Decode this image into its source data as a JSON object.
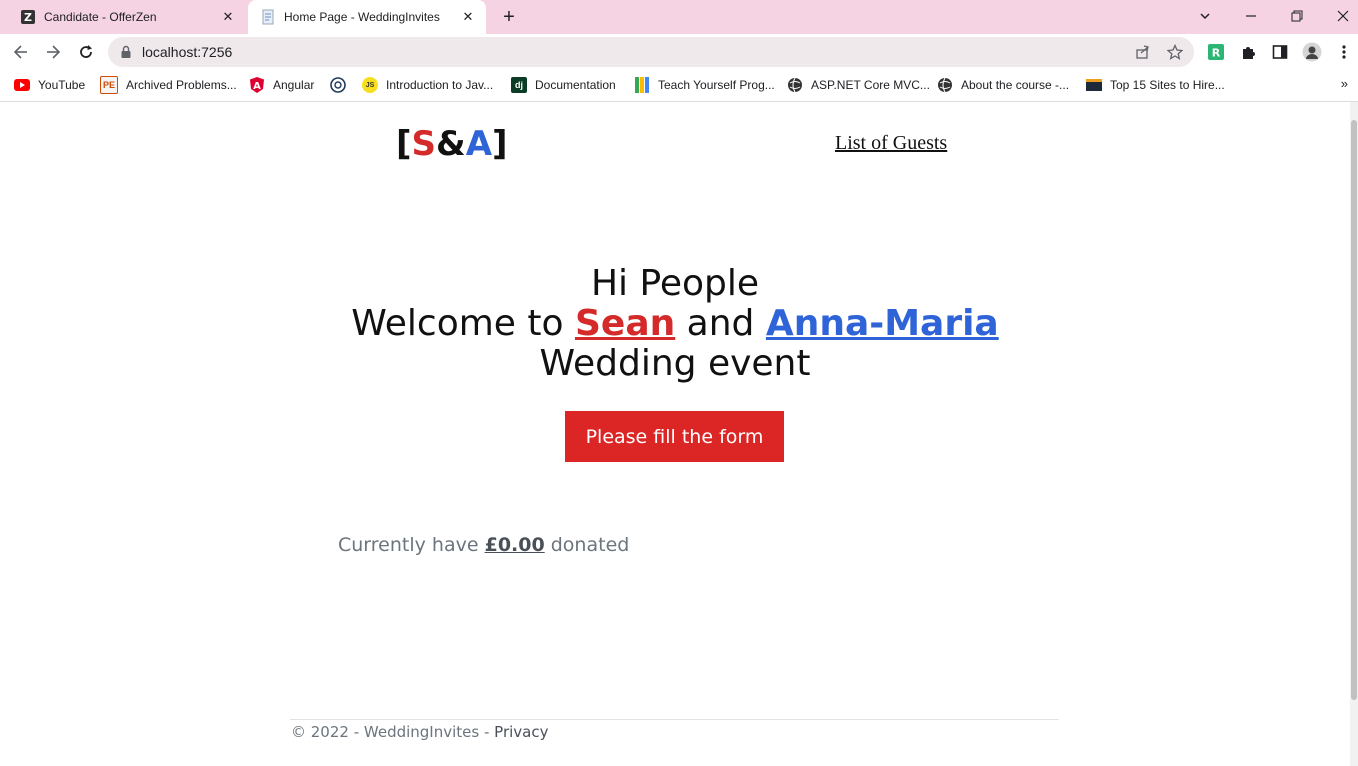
{
  "browser": {
    "tabs": [
      {
        "title": "Candidate - OfferZen",
        "active": false
      },
      {
        "title": "Home Page - WeddingInvites",
        "active": true
      }
    ],
    "url": "localhost:7256",
    "bookmarks": [
      {
        "label": "YouTube",
        "icon": "youtube-icon"
      },
      {
        "label": "Archived Problems...",
        "icon": "project-euler-icon"
      },
      {
        "label": "Angular",
        "icon": "angular-icon"
      },
      {
        "label": "",
        "icon": "globe-icon"
      },
      {
        "label": "Introduction to Jav...",
        "icon": "js-icon"
      },
      {
        "label": "Documentation",
        "icon": "django-icon"
      },
      {
        "label": "Teach Yourself Prog...",
        "icon": "bookmark-colored-icon"
      },
      {
        "label": "ASP.NET Core MVC...",
        "icon": "globe-icon"
      },
      {
        "label": "About the course -...",
        "icon": "globe-icon"
      },
      {
        "label": "Top 15 Sites to Hire...",
        "icon": "site-icon"
      }
    ],
    "more_bookmarks": "»"
  },
  "nav": {
    "brand": {
      "open": "[",
      "s": "S",
      "amp": "&",
      "a": "A",
      "close": "]"
    },
    "guests_link": "List of Guests"
  },
  "hero": {
    "line1": "Hi People",
    "welcome_prefix": "Welcome to ",
    "name1": "Sean",
    "and": " and ",
    "name2": "Anna-Maria",
    "line3": "Wedding event",
    "button": "Please fill the form"
  },
  "donation": {
    "prefix": "Currently have ",
    "amount": "£0.00",
    "suffix": " donated"
  },
  "footer": {
    "text": "© 2022 - WeddingInvites - ",
    "privacy": "Privacy"
  },
  "colors": {
    "red": "#dc2626",
    "blue": "#2f63d8",
    "tabstrip": "#f5d3e3"
  }
}
